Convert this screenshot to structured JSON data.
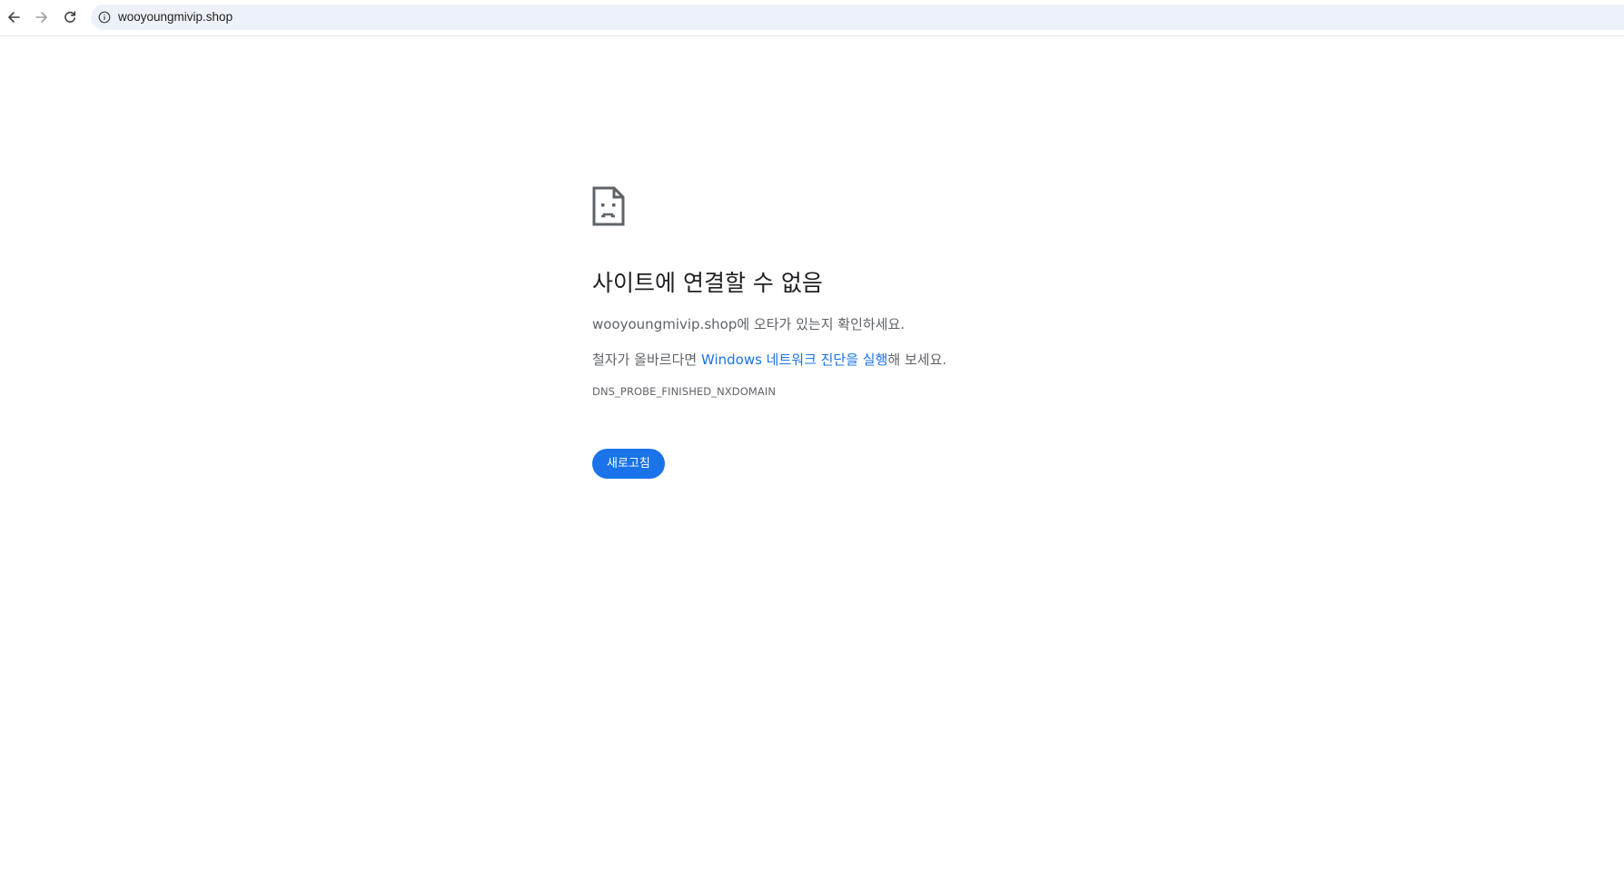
{
  "browser": {
    "back_icon": "arrow-left-icon",
    "forward_icon": "arrow-right-icon",
    "reload_icon": "reload-icon",
    "site_info_icon": "info-circle-icon",
    "url": "wooyoungmivip.shop"
  },
  "error_page": {
    "icon": "sad-document-icon",
    "heading": "사이트에 연결할 수 없음",
    "line1": {
      "domain": "wooyoungmivip.shop",
      "suffix": "에 오타가 있는지 확인하세요."
    },
    "line2": {
      "prefix": "철자가 올바르다면 ",
      "link": "Windows 네트워크 진단을 실행",
      "suffix": "해 보세요."
    },
    "error_code": "DNS_PROBE_FINISHED_NXDOMAIN",
    "reload_button": "새로고침"
  },
  "colors": {
    "accent": "#1a73e8",
    "omnibox_bg": "#edf2fa",
    "body_text": "#5f6368",
    "heading_text": "#202124"
  }
}
